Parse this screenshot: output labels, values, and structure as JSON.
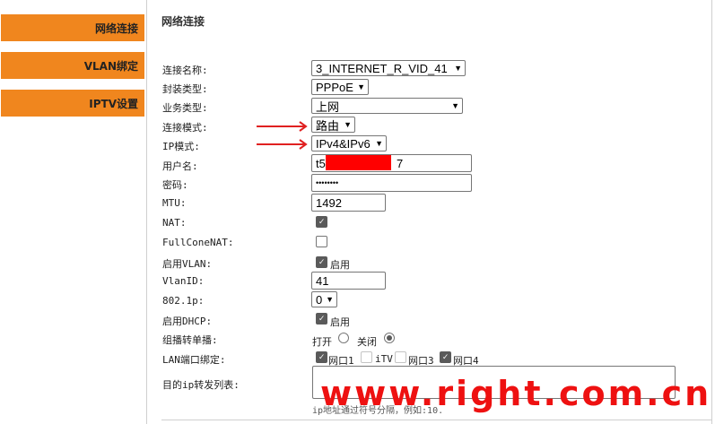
{
  "sidebar": {
    "items": [
      {
        "label": "网络连接"
      },
      {
        "label": "VLAN绑定"
      },
      {
        "label": "IPTV设置"
      }
    ]
  },
  "main": {
    "title": "网络连接",
    "fields": {
      "conn_name": {
        "label": "连接名称:",
        "value": "3_INTERNET_R_VID_41"
      },
      "encap": {
        "label": "封装类型:",
        "value": "PPPoE"
      },
      "service": {
        "label": "业务类型:",
        "value": "上网"
      },
      "conn_mode": {
        "label": "连接模式:",
        "value": "路由"
      },
      "ip_mode": {
        "label": "IP模式:",
        "value": "IPv4&IPv6"
      },
      "username": {
        "label": "用户名:",
        "value_prefix": "t5",
        "value_suffix": "7"
      },
      "password": {
        "label": "密码:",
        "value": "••••••••"
      },
      "mtu": {
        "label": "MTU:",
        "value": "1492"
      },
      "nat": {
        "label": "NAT:",
        "checked": true
      },
      "fullcone": {
        "label": "FullConeNAT:",
        "checked": false
      },
      "enable_vlan": {
        "label": "启用VLAN:",
        "checked": true,
        "caption": "启用"
      },
      "vlanid": {
        "label": "VlanID:",
        "value": "41"
      },
      "dot1p": {
        "label": "802.1p:",
        "value": "0"
      },
      "enable_dhcp": {
        "label": "启用DHCP:",
        "checked": true,
        "caption": "启用"
      },
      "multicast": {
        "label": "组播转单播:",
        "on_label": "打开",
        "off_label": "关闭",
        "selected": "off"
      },
      "lan_bind": {
        "label": "LAN端口绑定:",
        "ports": [
          {
            "label": "网口1",
            "checked": true,
            "disabled": false
          },
          {
            "label": "iTV",
            "checked": false,
            "disabled": true
          },
          {
            "label": "网口3",
            "checked": false,
            "disabled": true
          },
          {
            "label": "网口4",
            "checked": true,
            "disabled": false
          }
        ]
      },
      "ip_forward": {
        "label": "目的ip转发列表:"
      }
    },
    "hint_partial": "ip地址通过符号分隔，例如:10."
  },
  "watermark": "www.right.com.cn",
  "colors": {
    "nav": "#f0861e",
    "annotation": "#e02020",
    "watermark": "#ee1111"
  }
}
